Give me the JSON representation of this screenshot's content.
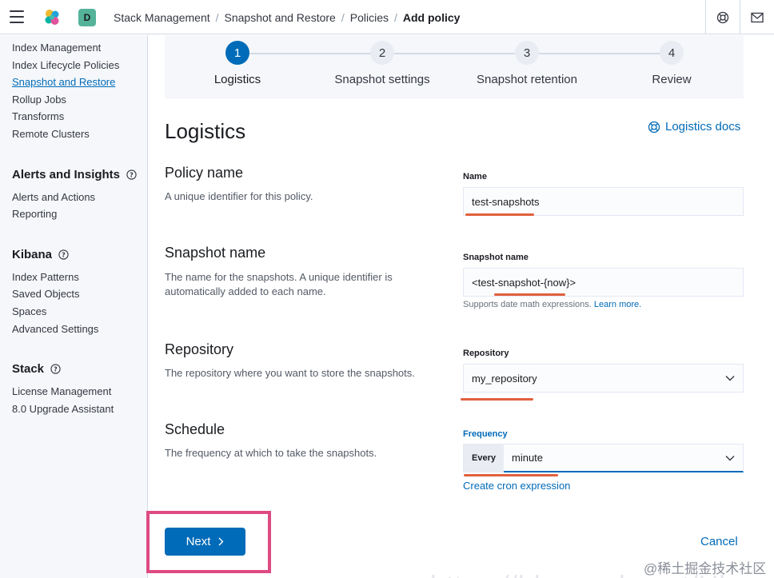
{
  "header": {
    "space_initial": "D",
    "breadcrumbs": [
      "Stack Management",
      "Snapshot and Restore",
      "Policies",
      "Add policy"
    ]
  },
  "sidebar": {
    "data_items": [
      "Index Management",
      "Index Lifecycle Policies",
      "Snapshot and Restore",
      "Rollup Jobs",
      "Transforms",
      "Remote Clusters"
    ],
    "active_item": "Snapshot and Restore",
    "groups": {
      "alerts": {
        "title": "Alerts and Insights",
        "items": [
          "Alerts and Actions",
          "Reporting"
        ]
      },
      "kibana": {
        "title": "Kibana",
        "items": [
          "Index Patterns",
          "Saved Objects",
          "Spaces",
          "Advanced Settings"
        ]
      },
      "stack": {
        "title": "Stack",
        "items": [
          "License Management",
          "8.0 Upgrade Assistant"
        ]
      }
    }
  },
  "steps": [
    {
      "number": "1",
      "label": "Logistics",
      "active": true
    },
    {
      "number": "2",
      "label": "Snapshot settings",
      "active": false
    },
    {
      "number": "3",
      "label": "Snapshot retention",
      "active": false
    },
    {
      "number": "4",
      "label": "Review",
      "active": false
    }
  ],
  "form": {
    "title": "Logistics",
    "docs_link": "Logistics docs",
    "policy_name": {
      "title": "Policy name",
      "description": "A unique identifier for this policy.",
      "label": "Name",
      "value": "test-snapshots"
    },
    "snapshot_name": {
      "title": "Snapshot name",
      "description": "The name for the snapshots. A unique identifier is automatically added to each name.",
      "label": "Snapshot name",
      "value": "<test-snapshot-{now}>",
      "help": "Supports date math expressions.",
      "help_link": "Learn more."
    },
    "repository": {
      "title": "Repository",
      "description": "The repository where you want to store the snapshots.",
      "label": "Repository",
      "value": "my_repository"
    },
    "schedule": {
      "title": "Schedule",
      "description": "The frequency at which to take the snapshots.",
      "label": "Frequency",
      "prefix": "Every",
      "value": "minute",
      "cron_link": "Create cron expression"
    }
  },
  "actions": {
    "next": "Next",
    "cancel": "Cancel"
  },
  "overlay": {
    "watermark": "@稀土掘金技术社区",
    "ghost_url": "https://blog.csdn.net/Ubu"
  },
  "colors": {
    "accent": "#006bb8",
    "highlight": "#de4b82",
    "annotation": "#e0603d"
  }
}
